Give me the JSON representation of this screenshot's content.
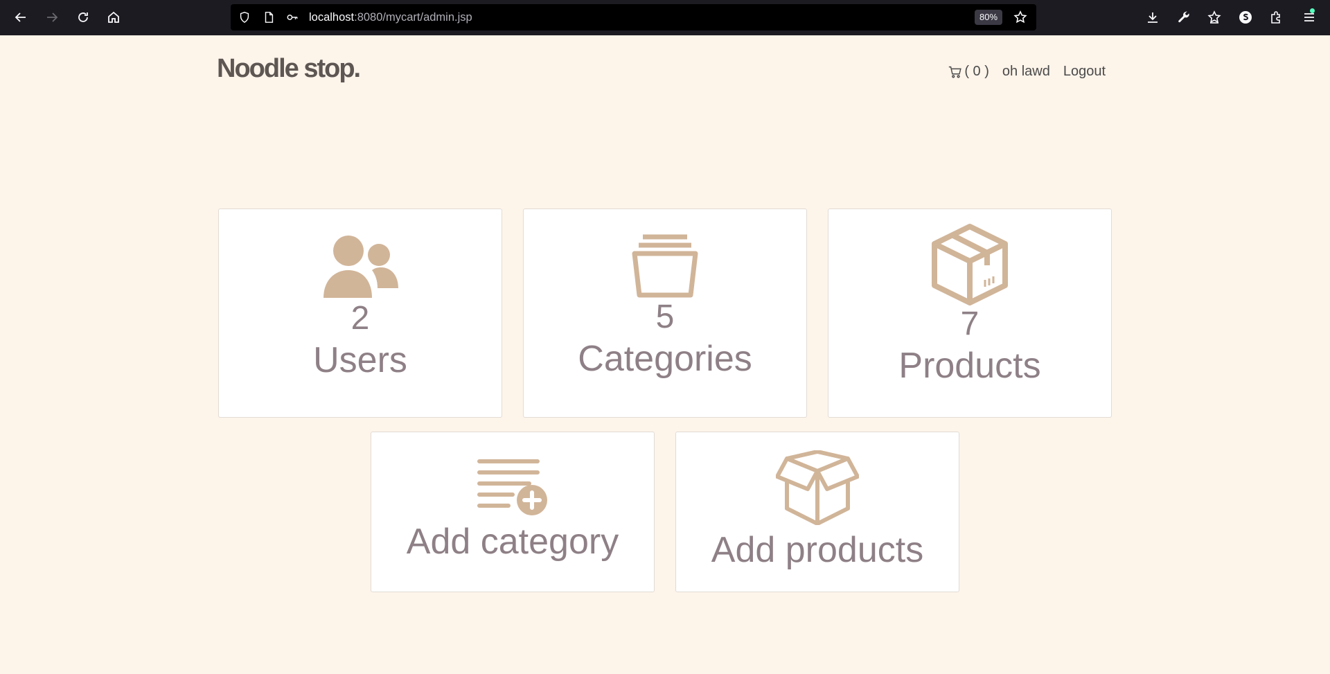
{
  "browser": {
    "url_host": "localhost",
    "url_rest": ":8080/mycart/admin.jsp",
    "zoom": "80%",
    "icons": [
      "back-icon",
      "forward-icon",
      "reload-icon",
      "home-icon",
      "shield-icon",
      "page-icon",
      "key-icon",
      "star-icon",
      "download-icon",
      "wrench-icon",
      "bookmark-star-icon",
      "account-icon",
      "extensions-icon",
      "menu-icon"
    ]
  },
  "header": {
    "brand": "Noodle stop.",
    "cart_count": "( 0 )",
    "user_name": "oh lawd",
    "logout_label": "Logout"
  },
  "stats": [
    {
      "count": "2",
      "label": "Users",
      "icon": "users-icon"
    },
    {
      "count": "5",
      "label": "Categories",
      "icon": "folder-stack-icon"
    },
    {
      "count": "7",
      "label": "Products",
      "icon": "box-icon"
    }
  ],
  "actions": [
    {
      "label": "Add category",
      "icon": "list-add-icon"
    },
    {
      "label": "Add products",
      "icon": "open-box-icon"
    }
  ],
  "colors": {
    "background": "#fdf4ea",
    "accent": "#d1b599",
    "text": "#8e8086",
    "brand": "#5d5652"
  }
}
